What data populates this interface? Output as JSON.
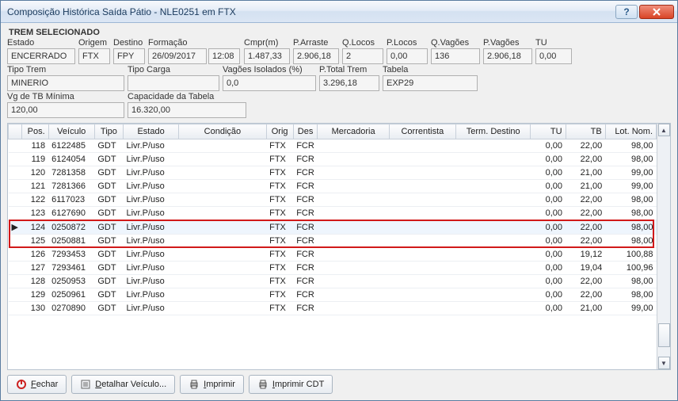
{
  "window": {
    "title": "Composição Histórica Saída Pátio  - NLE0251 em FTX"
  },
  "section_label": "TREM SELECIONADO",
  "fields": {
    "estado": {
      "label": "Estado",
      "value": "ENCERRADO"
    },
    "origem": {
      "label": "Origem",
      "value": "FTX"
    },
    "destino": {
      "label": "Destino",
      "value": "FPY"
    },
    "formacao_label": "Formação",
    "formacao_data": "26/09/2017",
    "formacao_hora": "12:08",
    "cmpr": {
      "label": "Cmpr(m)",
      "value": "1.487,33"
    },
    "parraste": {
      "label": "P.Arraste",
      "value": "2.906,18"
    },
    "qlocos": {
      "label": "Q.Locos",
      "value": "2"
    },
    "plocos": {
      "label": "P.Locos",
      "value": "0,00"
    },
    "qvagoes": {
      "label": "Q.Vagões",
      "value": "136"
    },
    "pvagoes": {
      "label": "P.Vagões",
      "value": "2.906,18"
    },
    "tu": {
      "label": "TU",
      "value": "0,00"
    },
    "tipotrem": {
      "label": "Tipo Trem",
      "value": "MINERIO"
    },
    "tipocarga": {
      "label": "Tipo Carga",
      "value": ""
    },
    "vagiso": {
      "label": "Vagões Isolados (%)",
      "value": "0,0"
    },
    "ptotal": {
      "label": "P.Total Trem",
      "value": "3.296,18"
    },
    "tabela": {
      "label": "Tabela",
      "value": "EXP29"
    },
    "vgtb": {
      "label": "Vg de TB Mínima",
      "value": "120,00"
    },
    "captab": {
      "label": "Capacidade da Tabela",
      "value": "16.320,00"
    }
  },
  "grid": {
    "headers": {
      "pos": "Pos.",
      "veiculo": "Veículo",
      "tipo": "Tipo",
      "estado": "Estado",
      "condicao": "Condição",
      "orig": "Orig",
      "des": "Des",
      "mercadoria": "Mercadoria",
      "correntista": "Correntista",
      "termdestino": "Term. Destino",
      "tu": "TU",
      "tb": "TB",
      "lotnom": "Lot. Nom."
    },
    "rows": [
      {
        "pos": "118",
        "veiculo": "6122485",
        "tipo": "GDT",
        "estado": "Livr.P/uso",
        "orig": "FTX",
        "des": "FCR",
        "tu": "0,00",
        "tb": "22,00",
        "lot": "98,00"
      },
      {
        "pos": "119",
        "veiculo": "6124054",
        "tipo": "GDT",
        "estado": "Livr.P/uso",
        "orig": "FTX",
        "des": "FCR",
        "tu": "0,00",
        "tb": "22,00",
        "lot": "98,00"
      },
      {
        "pos": "120",
        "veiculo": "7281358",
        "tipo": "GDT",
        "estado": "Livr.P/uso",
        "orig": "FTX",
        "des": "FCR",
        "tu": "0,00",
        "tb": "21,00",
        "lot": "99,00"
      },
      {
        "pos": "121",
        "veiculo": "7281366",
        "tipo": "GDT",
        "estado": "Livr.P/uso",
        "orig": "FTX",
        "des": "FCR",
        "tu": "0,00",
        "tb": "21,00",
        "lot": "99,00"
      },
      {
        "pos": "122",
        "veiculo": "6117023",
        "tipo": "GDT",
        "estado": "Livr.P/uso",
        "orig": "FTX",
        "des": "FCR",
        "tu": "0,00",
        "tb": "22,00",
        "lot": "98,00"
      },
      {
        "pos": "123",
        "veiculo": "6127690",
        "tipo": "GDT",
        "estado": "Livr.P/uso",
        "orig": "FTX",
        "des": "FCR",
        "tu": "0,00",
        "tb": "22,00",
        "lot": "98,00"
      },
      {
        "pos": "124",
        "veiculo": "0250872",
        "tipo": "GDT",
        "estado": "Livr.P/uso",
        "orig": "FTX",
        "des": "FCR",
        "tu": "0,00",
        "tb": "22,00",
        "lot": "98,00",
        "selected": true
      },
      {
        "pos": "125",
        "veiculo": "0250881",
        "tipo": "GDT",
        "estado": "Livr.P/uso",
        "orig": "FTX",
        "des": "FCR",
        "tu": "0,00",
        "tb": "22,00",
        "lot": "98,00"
      },
      {
        "pos": "126",
        "veiculo": "7293453",
        "tipo": "GDT",
        "estado": "Livr.P/uso",
        "orig": "FTX",
        "des": "FCR",
        "tu": "0,00",
        "tb": "19,12",
        "lot": "100,88"
      },
      {
        "pos": "127",
        "veiculo": "7293461",
        "tipo": "GDT",
        "estado": "Livr.P/uso",
        "orig": "FTX",
        "des": "FCR",
        "tu": "0,00",
        "tb": "19,04",
        "lot": "100,96"
      },
      {
        "pos": "128",
        "veiculo": "0250953",
        "tipo": "GDT",
        "estado": "Livr.P/uso",
        "orig": "FTX",
        "des": "FCR",
        "tu": "0,00",
        "tb": "22,00",
        "lot": "98,00"
      },
      {
        "pos": "129",
        "veiculo": "0250961",
        "tipo": "GDT",
        "estado": "Livr.P/uso",
        "orig": "FTX",
        "des": "FCR",
        "tu": "0,00",
        "tb": "22,00",
        "lot": "98,00"
      },
      {
        "pos": "130",
        "veiculo": "0270890",
        "tipo": "GDT",
        "estado": "Livr.P/uso",
        "orig": "FTX",
        "des": "FCR",
        "tu": "0,00",
        "tb": "21,00",
        "lot": "99,00"
      }
    ],
    "highlight_rows": [
      6,
      7
    ]
  },
  "footer": {
    "fechar_pre": "F",
    "fechar_rest": "echar",
    "detalhar_pre": "D",
    "detalhar_rest": "etalhar Veículo...",
    "imprimir_pre": "I",
    "imprimir_rest": "mprimir",
    "imprimircdt_pre": "I",
    "imprimircdt_rest": "mprimir CDT"
  }
}
